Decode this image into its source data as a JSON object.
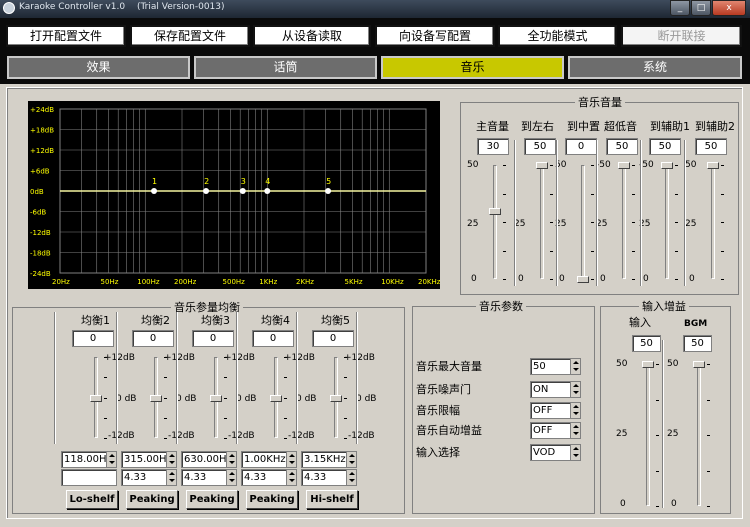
{
  "window": {
    "title": "Karaoke Controller v1.0",
    "subtitle": "(Trial Version-0013)",
    "buttons": [
      "_",
      "□",
      "x"
    ]
  },
  "toolbar": [
    "打开配置文件",
    "保存配置文件",
    "从设备读取",
    "向设备写配置",
    "全功能模式",
    "断开联接"
  ],
  "tabs": [
    "效果",
    "话筒",
    "音乐",
    "系统"
  ],
  "graph": {
    "ylabels": [
      "+24dB",
      "+18dB",
      "+12dB",
      "+6dB",
      "0dB",
      "-6dB",
      "-12dB",
      "-18dB",
      "-24dB"
    ],
    "xlabels": [
      "20Hz",
      "50Hz",
      "100Hz",
      "200Hz",
      "500Hz",
      "1KHz",
      "2KHz",
      "5KHz",
      "10KHz",
      "20KHz"
    ],
    "points": [
      "1",
      "2",
      "3",
      "4",
      "5"
    ]
  },
  "music_volume": {
    "title": "音乐音量",
    "channels": [
      {
        "label": "主音量",
        "value": "30",
        "top": "50",
        "mid": "25",
        "bot": "0"
      },
      {
        "label": "到左右",
        "value": "50",
        "top": "",
        "mid": "25",
        "bot": "0"
      },
      {
        "label": "到中置",
        "value": "0",
        "top": "50",
        "mid": "25",
        "bot": "0"
      },
      {
        "label": "超低音",
        "value": "50",
        "top": "-50",
        "mid": "25",
        "bot": "0"
      },
      {
        "label": "到辅助1",
        "value": "50",
        "top": "-50",
        "mid": "25",
        "bot": "0"
      },
      {
        "label": "到辅助2",
        "value": "50",
        "top": "50",
        "mid": "25",
        "bot": "0"
      }
    ]
  },
  "eq": {
    "title": "音乐参量均衡",
    "bands": [
      {
        "label": "均衡1",
        "value": "0",
        "top": "+12dB",
        "mid": "0 dB",
        "bot": "-12dB",
        "freq": "118.00H",
        "q": "4.33",
        "type": "Lo-shelf"
      },
      {
        "label": "均衡2",
        "value": "0",
        "top": "+12dB",
        "mid": "0 dB",
        "bot": "-12dB",
        "freq": "315.00H",
        "q": "4.33",
        "type": "Peaking"
      },
      {
        "label": "均衡3",
        "value": "0",
        "top": "+12dB",
        "mid": "0 dB",
        "bot": "-12dB",
        "freq": "630.00H",
        "q": "4.33",
        "type": "Peaking"
      },
      {
        "label": "均衡4",
        "value": "0",
        "top": "+12dB",
        "mid": "0 dB",
        "bot": "-12dB",
        "freq": "1.00KHz",
        "q": "4.33",
        "type": "Peaking"
      },
      {
        "label": "均衡5",
        "value": "0",
        "top": "+12dB",
        "mid": "0 dB",
        "bot": "-12dB",
        "freq": "3.15KHz",
        "q": "4.33",
        "type": "Hi-shelf"
      }
    ]
  },
  "params": {
    "title": "音乐参数",
    "rows": [
      {
        "label": "音乐最大音量",
        "value": "50"
      },
      {
        "label": "音乐噪声门",
        "value": "ON"
      },
      {
        "label": "音乐限幅",
        "value": "OFF"
      },
      {
        "label": "音乐自动增益",
        "value": "OFF"
      },
      {
        "label": "输入选择",
        "value": "VOD"
      }
    ]
  },
  "gain": {
    "title": "输入增益",
    "channels": [
      {
        "label": "输入",
        "value": "50",
        "top": "50",
        "mid": "25",
        "bot": "0"
      },
      {
        "label": "BGM",
        "value": "50",
        "top": "50",
        "mid": "25",
        "bot": "0"
      }
    ]
  },
  "colors": {
    "graph_bg": "#000000",
    "grid": "#808080",
    "curve": "#f5f5a0",
    "active_tab": "#c8c800",
    "labels": "#ffff00"
  }
}
